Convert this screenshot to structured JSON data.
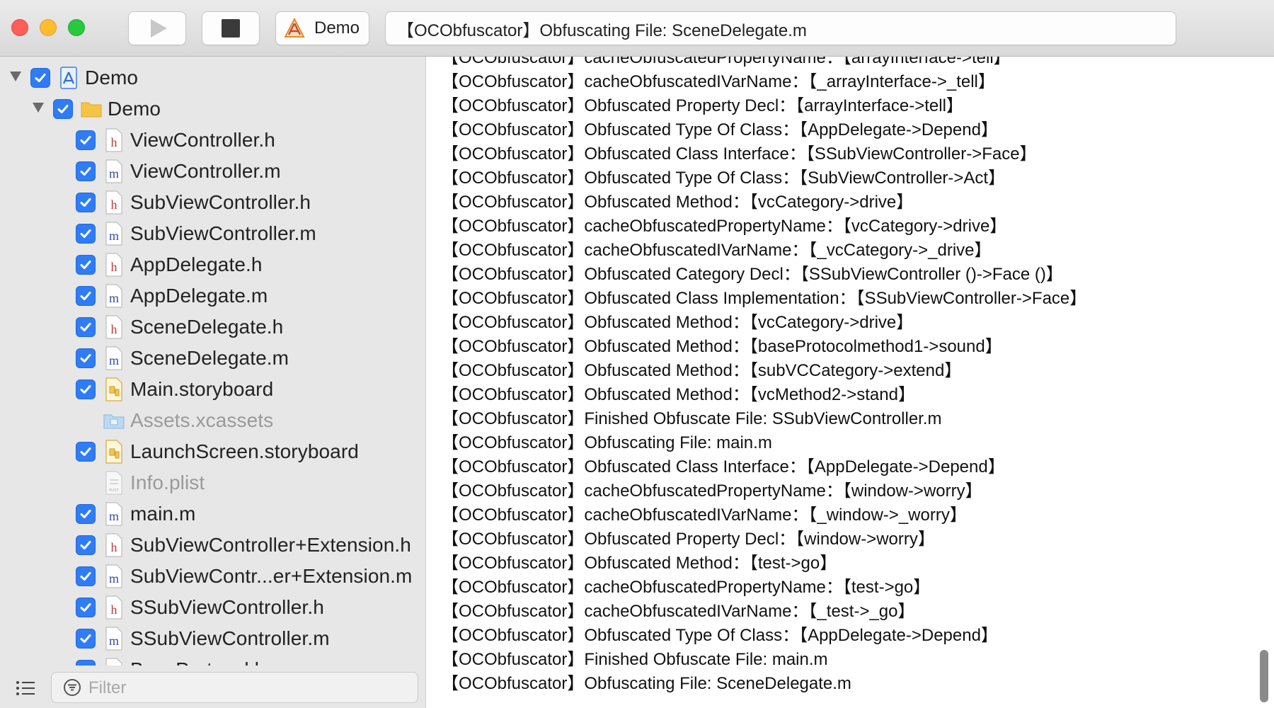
{
  "toolbar": {
    "scheme_label": "Demo",
    "status_text": "【OCObfuscator】Obfuscating File: SceneDelegate.m"
  },
  "sidebar": {
    "items": [
      {
        "label": "Demo",
        "level": 0,
        "type": "project",
        "checked": true,
        "disclosure": true,
        "dim": false
      },
      {
        "label": "Demo",
        "level": 1,
        "type": "folder",
        "checked": true,
        "disclosure": true,
        "dim": false
      },
      {
        "label": "ViewController.h",
        "level": 2,
        "type": "h",
        "checked": true,
        "disclosure": false,
        "dim": false
      },
      {
        "label": "ViewController.m",
        "level": 2,
        "type": "m",
        "checked": true,
        "disclosure": false,
        "dim": false
      },
      {
        "label": "SubViewController.h",
        "level": 2,
        "type": "h",
        "checked": true,
        "disclosure": false,
        "dim": false
      },
      {
        "label": "SubViewController.m",
        "level": 2,
        "type": "m",
        "checked": true,
        "disclosure": false,
        "dim": false
      },
      {
        "label": "AppDelegate.h",
        "level": 2,
        "type": "h",
        "checked": true,
        "disclosure": false,
        "dim": false
      },
      {
        "label": "AppDelegate.m",
        "level": 2,
        "type": "m",
        "checked": true,
        "disclosure": false,
        "dim": false
      },
      {
        "label": "SceneDelegate.h",
        "level": 2,
        "type": "h",
        "checked": true,
        "disclosure": false,
        "dim": false
      },
      {
        "label": "SceneDelegate.m",
        "level": 2,
        "type": "m",
        "checked": true,
        "disclosure": false,
        "dim": false
      },
      {
        "label": "Main.storyboard",
        "level": 2,
        "type": "storyboard",
        "checked": true,
        "disclosure": false,
        "dim": false
      },
      {
        "label": "Assets.xcassets",
        "level": 2,
        "type": "assets",
        "checked": false,
        "disclosure": false,
        "dim": true
      },
      {
        "label": "LaunchScreen.storyboard",
        "level": 2,
        "type": "storyboard",
        "checked": true,
        "disclosure": false,
        "dim": false
      },
      {
        "label": "Info.plist",
        "level": 2,
        "type": "plist",
        "checked": false,
        "disclosure": false,
        "dim": true
      },
      {
        "label": "main.m",
        "level": 2,
        "type": "m",
        "checked": true,
        "disclosure": false,
        "dim": false
      },
      {
        "label": "SubViewController+Extension.h",
        "level": 2,
        "type": "h",
        "checked": true,
        "disclosure": false,
        "dim": false
      },
      {
        "label": "SubViewContr...er+Extension.m",
        "level": 2,
        "type": "m",
        "checked": true,
        "disclosure": false,
        "dim": false
      },
      {
        "label": "SSubViewController.h",
        "level": 2,
        "type": "h",
        "checked": true,
        "disclosure": false,
        "dim": false
      },
      {
        "label": "SSubViewController.m",
        "level": 2,
        "type": "m",
        "checked": true,
        "disclosure": false,
        "dim": false
      },
      {
        "label": "BaseProtocol.h",
        "level": 2,
        "type": "h",
        "checked": true,
        "disclosure": false,
        "dim": false
      }
    ],
    "filter_placeholder": "Filter"
  },
  "log": {
    "lines": [
      "【OCObfuscator】cacheObfuscatedPropertyName：【arrayInterface->tell】",
      "【OCObfuscator】cacheObfuscatedIVarName：【_arrayInterface->_tell】",
      "【OCObfuscator】Obfuscated Property Decl：【arrayInterface->tell】",
      "【OCObfuscator】Obfuscated Type Of Class：【AppDelegate->Depend】",
      "【OCObfuscator】Obfuscated Class Interface：【SSubViewController->Face】",
      "【OCObfuscator】Obfuscated Type Of Class：【SubViewController->Act】",
      "【OCObfuscator】Obfuscated Method：【vcCategory->drive】",
      "【OCObfuscator】cacheObfuscatedPropertyName：【vcCategory->drive】",
      "【OCObfuscator】cacheObfuscatedIVarName：【_vcCategory->_drive】",
      "【OCObfuscator】Obfuscated Category Decl：【SSubViewController ()->Face ()】",
      "【OCObfuscator】Obfuscated Class Implementation：【SSubViewController->Face】",
      "【OCObfuscator】Obfuscated Method：【vcCategory->drive】",
      "【OCObfuscator】Obfuscated Method：【baseProtocolmethod1->sound】",
      "【OCObfuscator】Obfuscated Method：【subVCCategory->extend】",
      "【OCObfuscator】Obfuscated Method：【vcMethod2->stand】",
      "【OCObfuscator】Finished Obfuscate File: SSubViewController.m",
      "【OCObfuscator】Obfuscating File: main.m",
      "【OCObfuscator】Obfuscated Class Interface：【AppDelegate->Depend】",
      "【OCObfuscator】cacheObfuscatedPropertyName：【window->worry】",
      "【OCObfuscator】cacheObfuscatedIVarName：【_window->_worry】",
      "【OCObfuscator】Obfuscated Property Decl：【window->worry】",
      "【OCObfuscator】Obfuscated Method：【test->go】",
      "【OCObfuscator】cacheObfuscatedPropertyName：【test->go】",
      "【OCObfuscator】cacheObfuscatedIVarName：【_test->_go】",
      "【OCObfuscator】Obfuscated Type Of Class：【AppDelegate->Depend】",
      "【OCObfuscator】Finished Obfuscate File: main.m",
      "【OCObfuscator】Obfuscating File: SceneDelegate.m"
    ]
  },
  "colors": {
    "checkbox": "#2f7cf6",
    "folder": "#f6c444",
    "traffic_close": "#fd5f57",
    "traffic_min": "#febc2e",
    "traffic_max": "#28c840"
  }
}
